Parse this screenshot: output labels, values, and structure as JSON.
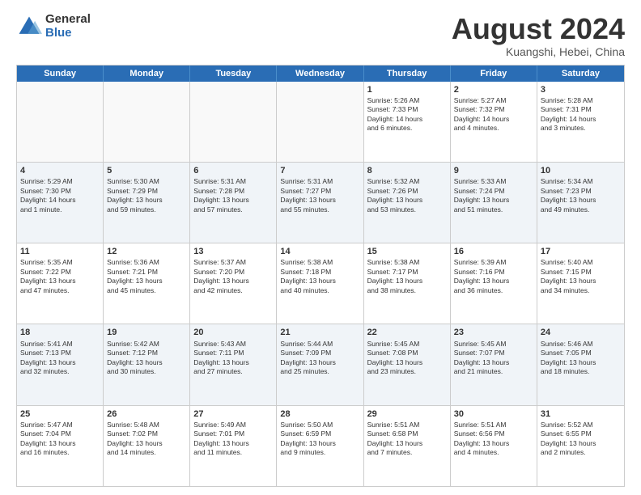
{
  "logo": {
    "general": "General",
    "blue": "Blue"
  },
  "title": "August 2024",
  "location": "Kuangshi, Hebei, China",
  "header_days": [
    "Sunday",
    "Monday",
    "Tuesday",
    "Wednesday",
    "Thursday",
    "Friday",
    "Saturday"
  ],
  "rows": [
    {
      "alt": false,
      "cells": [
        {
          "day": "",
          "lines": []
        },
        {
          "day": "",
          "lines": []
        },
        {
          "day": "",
          "lines": []
        },
        {
          "day": "",
          "lines": []
        },
        {
          "day": "1",
          "lines": [
            "Sunrise: 5:26 AM",
            "Sunset: 7:33 PM",
            "Daylight: 14 hours",
            "and 6 minutes."
          ]
        },
        {
          "day": "2",
          "lines": [
            "Sunrise: 5:27 AM",
            "Sunset: 7:32 PM",
            "Daylight: 14 hours",
            "and 4 minutes."
          ]
        },
        {
          "day": "3",
          "lines": [
            "Sunrise: 5:28 AM",
            "Sunset: 7:31 PM",
            "Daylight: 14 hours",
            "and 3 minutes."
          ]
        }
      ]
    },
    {
      "alt": true,
      "cells": [
        {
          "day": "4",
          "lines": [
            "Sunrise: 5:29 AM",
            "Sunset: 7:30 PM",
            "Daylight: 14 hours",
            "and 1 minute."
          ]
        },
        {
          "day": "5",
          "lines": [
            "Sunrise: 5:30 AM",
            "Sunset: 7:29 PM",
            "Daylight: 13 hours",
            "and 59 minutes."
          ]
        },
        {
          "day": "6",
          "lines": [
            "Sunrise: 5:31 AM",
            "Sunset: 7:28 PM",
            "Daylight: 13 hours",
            "and 57 minutes."
          ]
        },
        {
          "day": "7",
          "lines": [
            "Sunrise: 5:31 AM",
            "Sunset: 7:27 PM",
            "Daylight: 13 hours",
            "and 55 minutes."
          ]
        },
        {
          "day": "8",
          "lines": [
            "Sunrise: 5:32 AM",
            "Sunset: 7:26 PM",
            "Daylight: 13 hours",
            "and 53 minutes."
          ]
        },
        {
          "day": "9",
          "lines": [
            "Sunrise: 5:33 AM",
            "Sunset: 7:24 PM",
            "Daylight: 13 hours",
            "and 51 minutes."
          ]
        },
        {
          "day": "10",
          "lines": [
            "Sunrise: 5:34 AM",
            "Sunset: 7:23 PM",
            "Daylight: 13 hours",
            "and 49 minutes."
          ]
        }
      ]
    },
    {
      "alt": false,
      "cells": [
        {
          "day": "11",
          "lines": [
            "Sunrise: 5:35 AM",
            "Sunset: 7:22 PM",
            "Daylight: 13 hours",
            "and 47 minutes."
          ]
        },
        {
          "day": "12",
          "lines": [
            "Sunrise: 5:36 AM",
            "Sunset: 7:21 PM",
            "Daylight: 13 hours",
            "and 45 minutes."
          ]
        },
        {
          "day": "13",
          "lines": [
            "Sunrise: 5:37 AM",
            "Sunset: 7:20 PM",
            "Daylight: 13 hours",
            "and 42 minutes."
          ]
        },
        {
          "day": "14",
          "lines": [
            "Sunrise: 5:38 AM",
            "Sunset: 7:18 PM",
            "Daylight: 13 hours",
            "and 40 minutes."
          ]
        },
        {
          "day": "15",
          "lines": [
            "Sunrise: 5:38 AM",
            "Sunset: 7:17 PM",
            "Daylight: 13 hours",
            "and 38 minutes."
          ]
        },
        {
          "day": "16",
          "lines": [
            "Sunrise: 5:39 AM",
            "Sunset: 7:16 PM",
            "Daylight: 13 hours",
            "and 36 minutes."
          ]
        },
        {
          "day": "17",
          "lines": [
            "Sunrise: 5:40 AM",
            "Sunset: 7:15 PM",
            "Daylight: 13 hours",
            "and 34 minutes."
          ]
        }
      ]
    },
    {
      "alt": true,
      "cells": [
        {
          "day": "18",
          "lines": [
            "Sunrise: 5:41 AM",
            "Sunset: 7:13 PM",
            "Daylight: 13 hours",
            "and 32 minutes."
          ]
        },
        {
          "day": "19",
          "lines": [
            "Sunrise: 5:42 AM",
            "Sunset: 7:12 PM",
            "Daylight: 13 hours",
            "and 30 minutes."
          ]
        },
        {
          "day": "20",
          "lines": [
            "Sunrise: 5:43 AM",
            "Sunset: 7:11 PM",
            "Daylight: 13 hours",
            "and 27 minutes."
          ]
        },
        {
          "day": "21",
          "lines": [
            "Sunrise: 5:44 AM",
            "Sunset: 7:09 PM",
            "Daylight: 13 hours",
            "and 25 minutes."
          ]
        },
        {
          "day": "22",
          "lines": [
            "Sunrise: 5:45 AM",
            "Sunset: 7:08 PM",
            "Daylight: 13 hours",
            "and 23 minutes."
          ]
        },
        {
          "day": "23",
          "lines": [
            "Sunrise: 5:45 AM",
            "Sunset: 7:07 PM",
            "Daylight: 13 hours",
            "and 21 minutes."
          ]
        },
        {
          "day": "24",
          "lines": [
            "Sunrise: 5:46 AM",
            "Sunset: 7:05 PM",
            "Daylight: 13 hours",
            "and 18 minutes."
          ]
        }
      ]
    },
    {
      "alt": false,
      "cells": [
        {
          "day": "25",
          "lines": [
            "Sunrise: 5:47 AM",
            "Sunset: 7:04 PM",
            "Daylight: 13 hours",
            "and 16 minutes."
          ]
        },
        {
          "day": "26",
          "lines": [
            "Sunrise: 5:48 AM",
            "Sunset: 7:02 PM",
            "Daylight: 13 hours",
            "and 14 minutes."
          ]
        },
        {
          "day": "27",
          "lines": [
            "Sunrise: 5:49 AM",
            "Sunset: 7:01 PM",
            "Daylight: 13 hours",
            "and 11 minutes."
          ]
        },
        {
          "day": "28",
          "lines": [
            "Sunrise: 5:50 AM",
            "Sunset: 6:59 PM",
            "Daylight: 13 hours",
            "and 9 minutes."
          ]
        },
        {
          "day": "29",
          "lines": [
            "Sunrise: 5:51 AM",
            "Sunset: 6:58 PM",
            "Daylight: 13 hours",
            "and 7 minutes."
          ]
        },
        {
          "day": "30",
          "lines": [
            "Sunrise: 5:51 AM",
            "Sunset: 6:56 PM",
            "Daylight: 13 hours",
            "and 4 minutes."
          ]
        },
        {
          "day": "31",
          "lines": [
            "Sunrise: 5:52 AM",
            "Sunset: 6:55 PM",
            "Daylight: 13 hours",
            "and 2 minutes."
          ]
        }
      ]
    }
  ]
}
